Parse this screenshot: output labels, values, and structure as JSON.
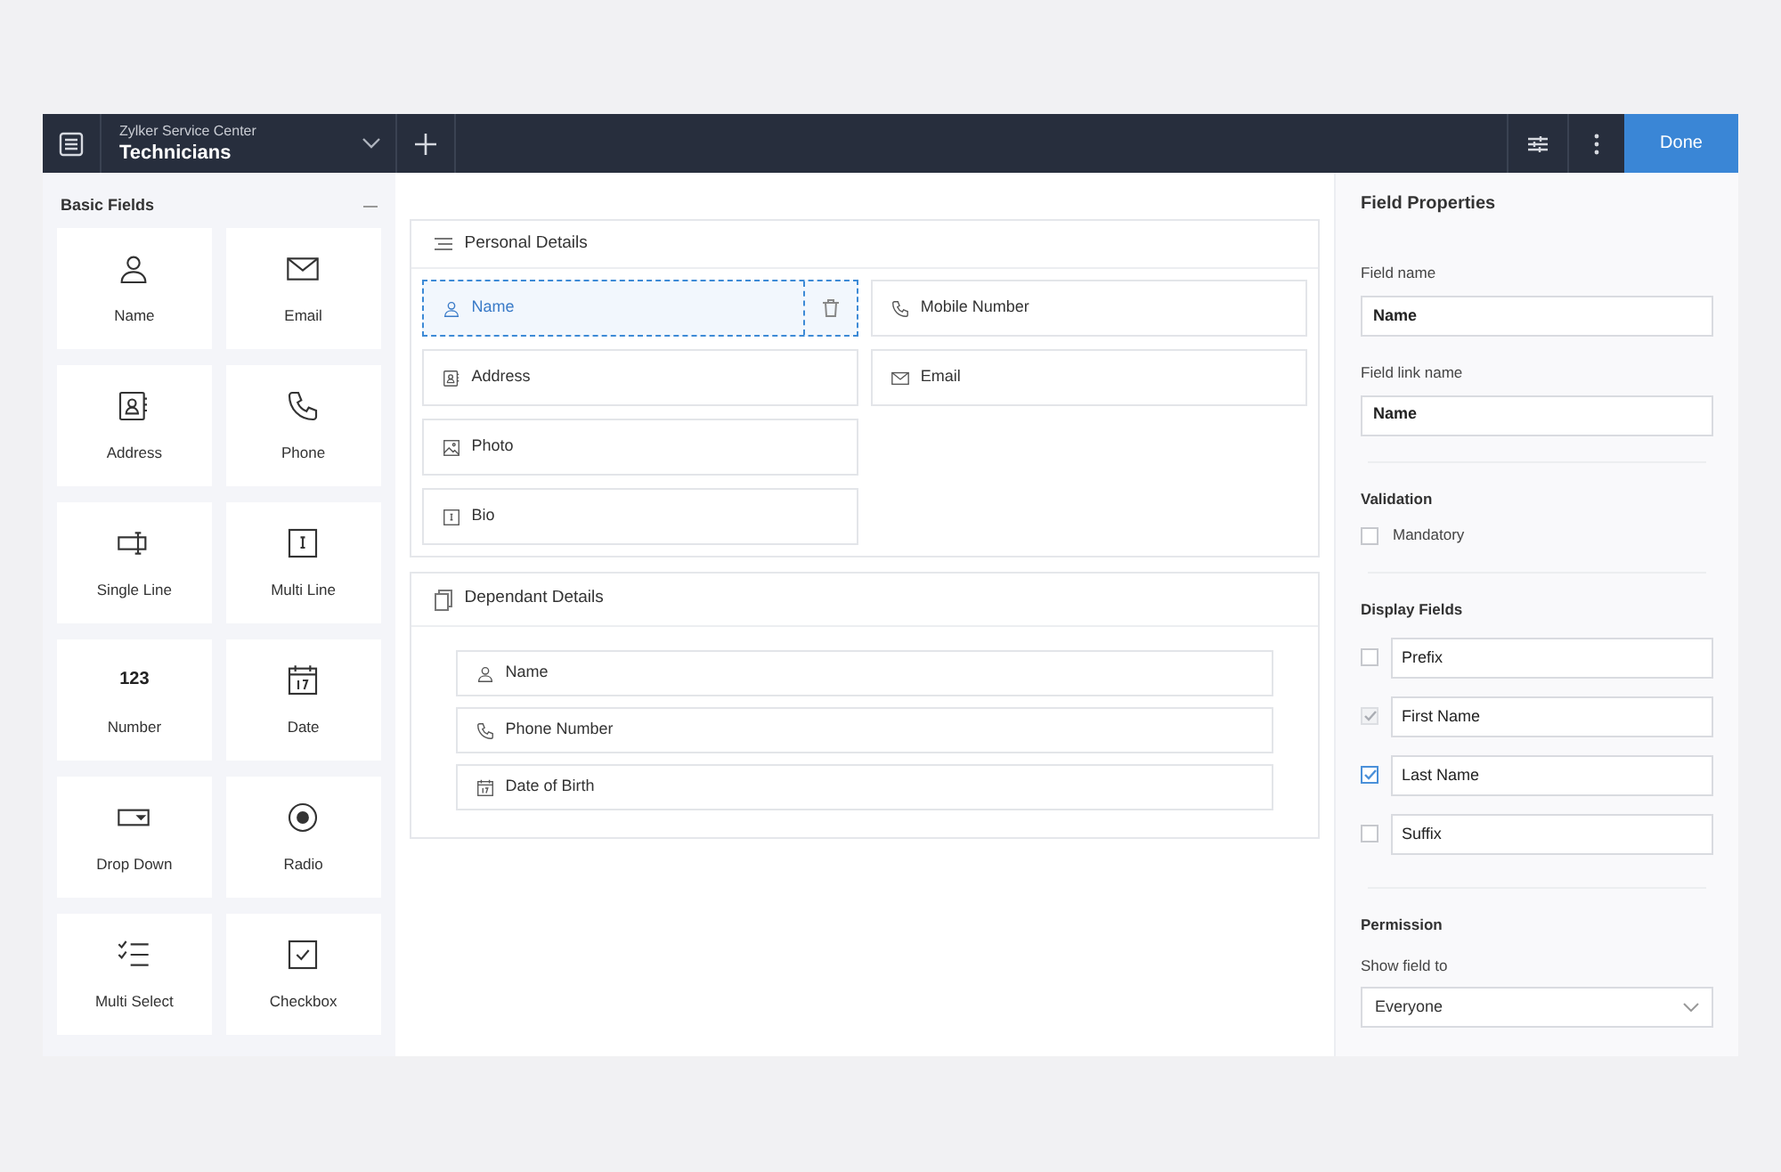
{
  "header": {
    "app_name": "Zylker Service Center",
    "form_name": "Technicians",
    "done_button": "Done"
  },
  "palette": {
    "title": "Basic Fields",
    "items": [
      {
        "label": "Name",
        "kind": "person"
      },
      {
        "label": "Email",
        "kind": "mail"
      },
      {
        "label": "Address",
        "kind": "address"
      },
      {
        "label": "Phone",
        "kind": "phone"
      },
      {
        "label": "Single Line",
        "kind": "singleline"
      },
      {
        "label": "Multi Line",
        "kind": "multiline"
      },
      {
        "label": "Number",
        "kind": "number",
        "glyph": "123"
      },
      {
        "label": "Date",
        "kind": "date"
      },
      {
        "label": "Drop Down",
        "kind": "dropdown"
      },
      {
        "label": "Radio",
        "kind": "radio"
      },
      {
        "label": "Multi Select",
        "kind": "multiselect"
      },
      {
        "label": "Checkbox",
        "kind": "checkbox"
      }
    ]
  },
  "sections": [
    {
      "title": "Personal Details",
      "kind": "personal",
      "columns": [
        {
          "fields": [
            {
              "label": "Name",
              "kind": "person",
              "selected": true
            },
            {
              "label": "Address",
              "kind": "address",
              "selected": false
            },
            {
              "label": "Photo",
              "kind": "photo",
              "selected": false
            },
            {
              "label": "Bio",
              "kind": "multiline",
              "selected": false
            }
          ]
        },
        {
          "fields": [
            {
              "label": "Mobile Number",
              "kind": "phone",
              "selected": false
            },
            {
              "label": "Email",
              "kind": "mail",
              "selected": false
            }
          ]
        }
      ]
    },
    {
      "title": "Dependant Details",
      "kind": "dependant",
      "fields": [
        {
          "label": "Name",
          "kind": "person",
          "selected": false
        },
        {
          "label": "Phone Number",
          "kind": "phone",
          "selected": false
        },
        {
          "label": "Date of Birth",
          "kind": "date",
          "selected": false
        }
      ]
    }
  ],
  "properties": {
    "title": "Field Properties",
    "field_name": {
      "label": "Field name",
      "value": "Name"
    },
    "field_link_name": {
      "label": "Field link name",
      "value": "Name"
    },
    "validation": {
      "title": "Validation",
      "options": [
        {
          "label": "Mandatory",
          "checked": false
        }
      ]
    },
    "display_fields": {
      "title": "Display Fields",
      "items": [
        {
          "value": "Prefix",
          "checked": false,
          "disabled": false
        },
        {
          "value": "First Name",
          "checked": true,
          "disabled": true
        },
        {
          "value": "Last Name",
          "checked": true,
          "disabled": false
        },
        {
          "value": "Suffix",
          "checked": false,
          "disabled": false
        }
      ]
    },
    "permission": {
      "title": "Permission",
      "label": "Show field to",
      "value": "Everyone"
    }
  }
}
